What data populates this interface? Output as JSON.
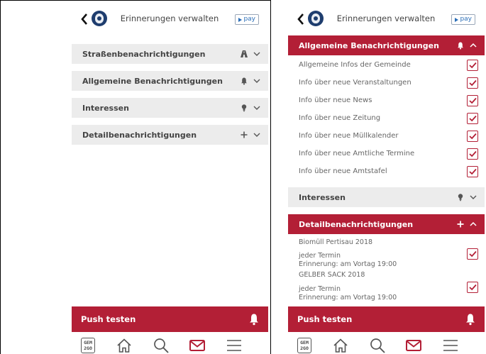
{
  "colors": {
    "accent": "#b31f36",
    "section_bg": "#ececec"
  },
  "left": {
    "topbar": {
      "title": "Erinnerungen verwalten",
      "pay_label": "pay"
    },
    "sections": [
      {
        "label": "Straßenbenachrichtigungen",
        "icon": "road-icon",
        "expanded": false
      },
      {
        "label": "Allgemeine Benachrichtigungen",
        "icon": "bell-icon",
        "expanded": false
      },
      {
        "label": "Interessen",
        "icon": "lightbulb-icon",
        "expanded": false
      },
      {
        "label": "Detailbenachrichtigungen",
        "icon": "plus-icon",
        "expanded": false
      }
    ],
    "push_label": "Push testen",
    "tabbar": {
      "logo_line1": "GEM",
      "logo_line2": "2GO"
    }
  },
  "right": {
    "topbar": {
      "title": "Erinnerungen verwalten",
      "pay_label": "pay"
    },
    "general_header": "Allgemeine Benachrichtigungen",
    "general_options": [
      {
        "label": "Allgemeine Infos der Gemeinde",
        "checked": true
      },
      {
        "label": "Info über neue Veranstaltungen",
        "checked": true
      },
      {
        "label": "Info über neue News",
        "checked": true
      },
      {
        "label": "Info über neue Zeitung",
        "checked": true
      },
      {
        "label": "Info über neue Müllkalender",
        "checked": true
      },
      {
        "label": "Info über neue Amtliche Termine",
        "checked": true
      },
      {
        "label": "Info über neue Amtstafel",
        "checked": true
      }
    ],
    "interests_header": "Interessen",
    "detail_header": "Detailbenachrichtigungen",
    "detail_items": [
      {
        "title": "Biomüll Pertisau 2018",
        "line1": "jeder Termin",
        "line2": "Erinnerung: am Vortag 19:00",
        "checked": true
      },
      {
        "title": "GELBER SACK 2018",
        "line1": "jeder Termin",
        "line2": "Erinnerung: am Vortag 19:00",
        "checked": true
      }
    ],
    "push_label": "Push testen",
    "tabbar": {
      "logo_line1": "GEM",
      "logo_line2": "2GO"
    }
  }
}
